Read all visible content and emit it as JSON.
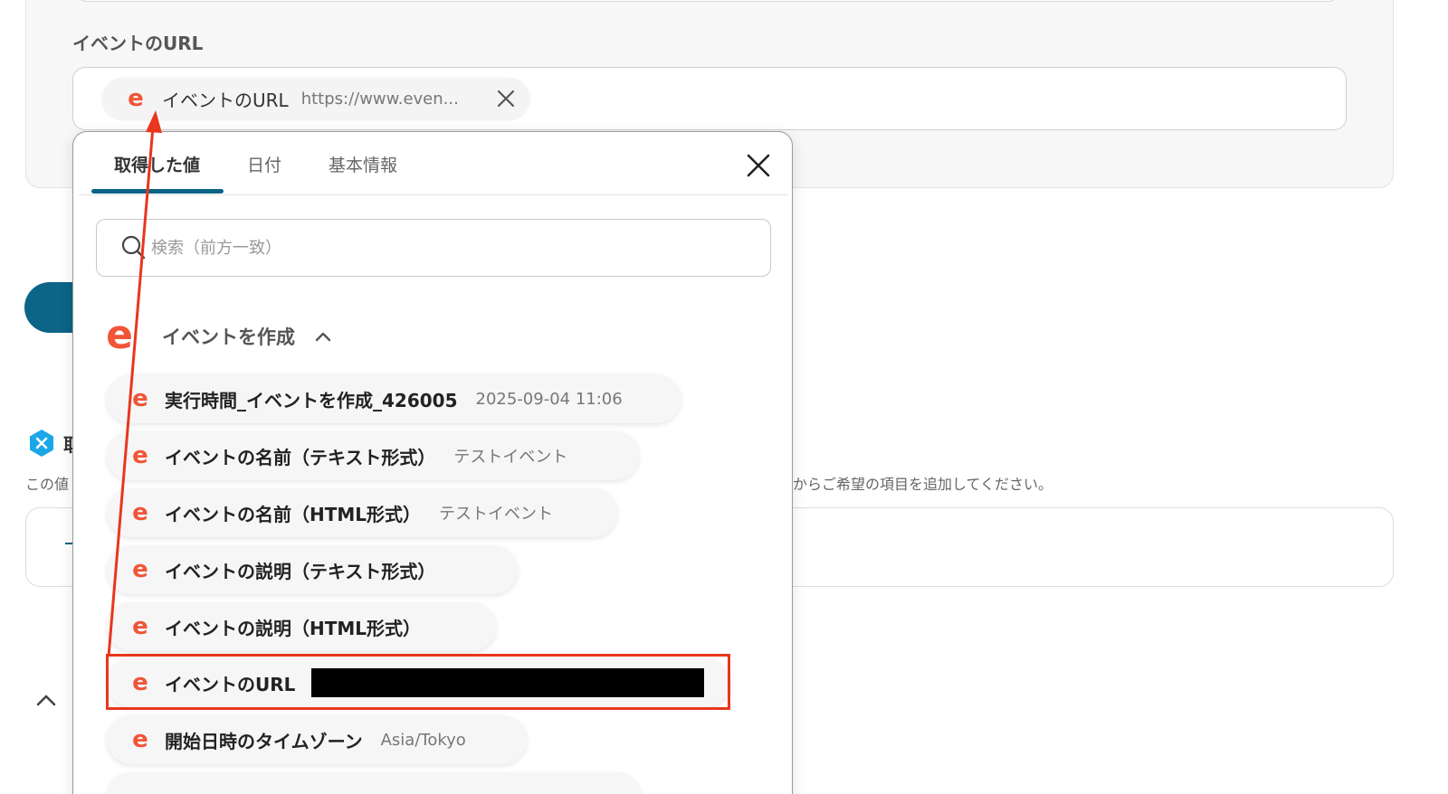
{
  "form": {
    "field_label": "イベントのURL",
    "chip": {
      "label": "イベントのURL",
      "value": "https://www.even..."
    }
  },
  "background": {
    "heading_fragment": "取",
    "hint_left": "この値",
    "hint_right": "からご希望の項目を追加してください。"
  },
  "panel": {
    "tabs": [
      {
        "label": "取得した値"
      },
      {
        "label": "日付"
      },
      {
        "label": "基本情報"
      }
    ],
    "search": {
      "placeholder": "検索（前方一致）"
    },
    "group": {
      "label": "イベントを作成"
    },
    "items": [
      {
        "label": "実行時間_イベントを作成_426005",
        "value": "2025-09-04 11:06"
      },
      {
        "label": "イベントの名前（テキスト形式）",
        "value": "テストイベント"
      },
      {
        "label": "イベントの名前（HTML形式）",
        "value": "テストイベント"
      },
      {
        "label": "イベントの説明（テキスト形式）",
        "value": ""
      },
      {
        "label": "イベントの説明（HTML形式）",
        "value": ""
      },
      {
        "label": "イベントのURL",
        "value": ""
      },
      {
        "label": "開始日時のタイムゾーン",
        "value": "Asia/Tokyo"
      }
    ]
  },
  "colors": {
    "accent": "#0c6487",
    "brand_icon": "#f05537",
    "highlight": "#e8371d"
  },
  "icons": [
    "eventbrite-icon",
    "close-icon",
    "search-icon",
    "chevron-up-icon",
    "x-badge-icon"
  ]
}
